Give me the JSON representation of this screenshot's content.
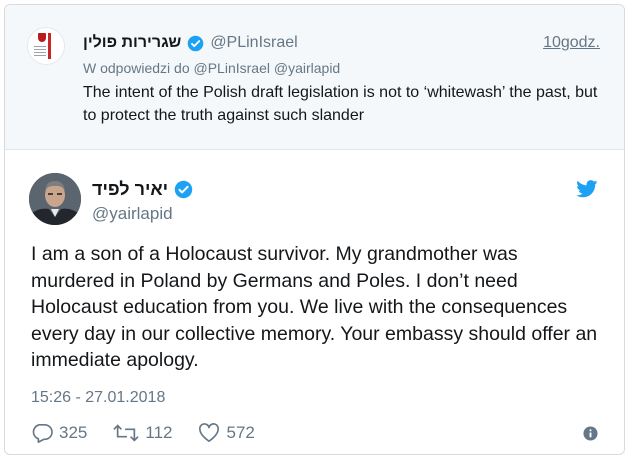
{
  "parent": {
    "name": "שגרירות פולין",
    "handle": "@PLinIsrael",
    "time": "10godz.",
    "reply_line": "W odpowiedzi do @PLinIsrael @yairlapid",
    "text": "The intent of the Polish draft legislation is not to ‘whitewash’ the past, but to protect the truth against such slander",
    "verified": true,
    "avatar_icon": "polish-embassy-emblem"
  },
  "tweet": {
    "name": "יאיר לפיד",
    "handle": "@yairlapid",
    "verified": true,
    "text": "I am a son of a Holocaust survivor. My grandmother was murdered in Poland by Germans and Poles. I don’t need Holocaust education from you. We live with the consequences every day in our collective memory. Your embassy should offer an immediate apology.",
    "timestamp": "15:26 - 27.01.2018",
    "replies": "325",
    "retweets": "112",
    "likes": "572"
  },
  "colors": {
    "verified": "#1da1f2",
    "twitter_blue": "#1da1f2",
    "secondary_text": "#657786",
    "parent_bg": "#f5f8fa"
  },
  "icons": [
    "verified-badge-icon",
    "twitter-bird-icon",
    "reply-icon",
    "retweet-icon",
    "like-heart-icon",
    "info-icon"
  ]
}
